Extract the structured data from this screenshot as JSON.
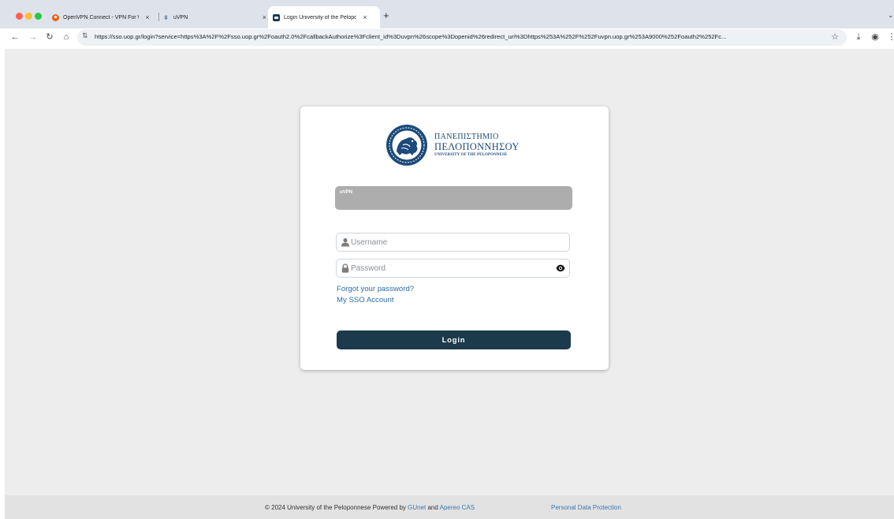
{
  "browser": {
    "tabs": [
      {
        "title": "OpenVPN Connect - VPN For Windows",
        "favicon": "openvpn-icon",
        "close": "×"
      },
      {
        "title": "uVPN",
        "favicon": "uvpn-icon",
        "close": "×"
      },
      {
        "title": "Login University of the Peloponnese",
        "favicon": "cas-icon",
        "close": "×",
        "active": true
      }
    ],
    "new_tab": "+",
    "url": "https://sso.uop.gr/login?service=https%3A%2F%2Fsso.uop.gr%2Foauth2.0%2FcallbackAuthorize%3Fclient_id%3Duvpn%26scope%3Dopenid%26redirect_uri%3Dhttps%253A%252F%252Fuvpn.uop.gr%253A9000%252Foauth2%252Fc...",
    "icons": {
      "back": "←",
      "forward": "→",
      "reload": "↻",
      "home": "⌂",
      "site_info": "⇅",
      "bookmark": "☆",
      "download": "⤓",
      "profile": "◉",
      "menu": "⋮",
      "tab_list": "⌄"
    }
  },
  "logo": {
    "line1": "ΠΑΝΕΠΙΣΤΗΜΙΟ",
    "line2": "ΠΕΛΟΠΟΝΝΗΣΟΥ",
    "line3": "UNIVERSITY OF THE PELOPONNESE"
  },
  "login": {
    "service_name": "uVPN",
    "username_placeholder": "Username",
    "password_placeholder": "Password",
    "forgot_password": "Forgot your password?",
    "sso_account": "My SSO Account",
    "login_button": "Login"
  },
  "footer": {
    "copyright": "© 2024 University of the Peloponnese Powered by",
    "gunet": "GUnet",
    "and": "and",
    "apereo": "Apereo CAS",
    "privacy": "Personal Data Protection"
  },
  "colors": {
    "primary_button": "#1b3a4b",
    "link": "#2a6da4",
    "logo_blue": "#1c4a7a",
    "page_background": "#ededed",
    "service_banner": "#adadad"
  }
}
